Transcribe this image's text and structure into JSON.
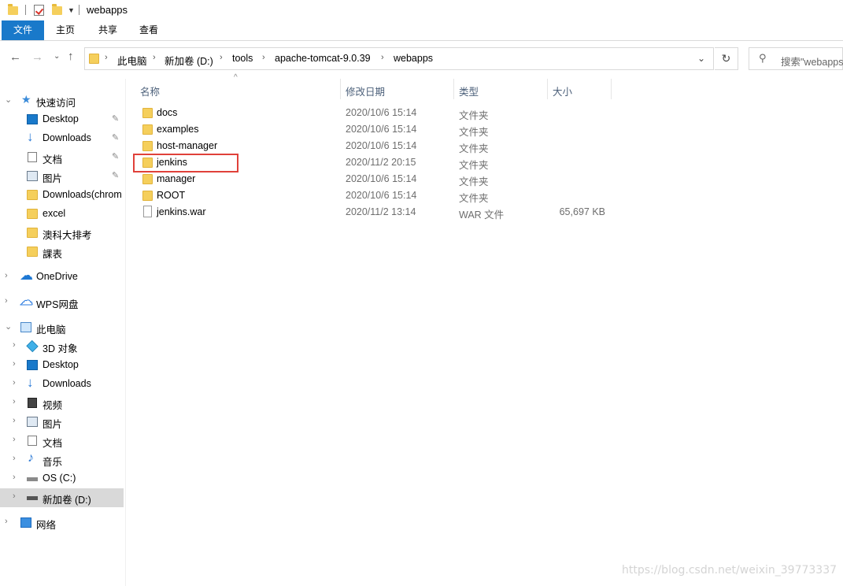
{
  "window": {
    "title": "webapps"
  },
  "ribbon": {
    "tabs": [
      "文件",
      "主页",
      "共享",
      "查看"
    ]
  },
  "address": {
    "crumbs": [
      "此电脑",
      "新加卷 (D:)",
      "tools",
      "apache-tomcat-9.0.39",
      "webapps"
    ],
    "search_placeholder": "搜索\"webapps\""
  },
  "nav": {
    "quick_access": "快速访问",
    "quick_items": [
      "Desktop",
      "Downloads",
      "文档",
      "图片",
      "Downloads(chrom",
      "excel",
      "澳科大排考",
      "課表"
    ],
    "onedrive": "OneDrive",
    "wps": "WPS网盘",
    "this_pc": "此电脑",
    "pc_items": [
      "3D 对象",
      "Desktop",
      "Downloads",
      "视频",
      "图片",
      "文档",
      "音乐",
      "OS (C:)",
      "新加卷 (D:)"
    ],
    "network": "网络"
  },
  "columns": {
    "name": "名称",
    "modified": "修改日期",
    "type": "类型",
    "size": "大小"
  },
  "files": [
    {
      "name": "docs",
      "modified": "2020/10/6 15:14",
      "type": "文件夹",
      "size": ""
    },
    {
      "name": "examples",
      "modified": "2020/10/6 15:14",
      "type": "文件夹",
      "size": ""
    },
    {
      "name": "host-manager",
      "modified": "2020/10/6 15:14",
      "type": "文件夹",
      "size": ""
    },
    {
      "name": "jenkins",
      "modified": "2020/11/2 20:15",
      "type": "文件夹",
      "size": ""
    },
    {
      "name": "manager",
      "modified": "2020/10/6 15:14",
      "type": "文件夹",
      "size": ""
    },
    {
      "name": "ROOT",
      "modified": "2020/10/6 15:14",
      "type": "文件夹",
      "size": ""
    },
    {
      "name": "jenkins.war",
      "modified": "2020/11/2 13:14",
      "type": "WAR 文件",
      "size": "65,697 KB"
    }
  ],
  "watermark": "https://blog.csdn.net/weixin_39773337",
  "colors": {
    "accent": "#1979ca",
    "highlight": "#e0413a",
    "folder": "#f5cf5c"
  }
}
